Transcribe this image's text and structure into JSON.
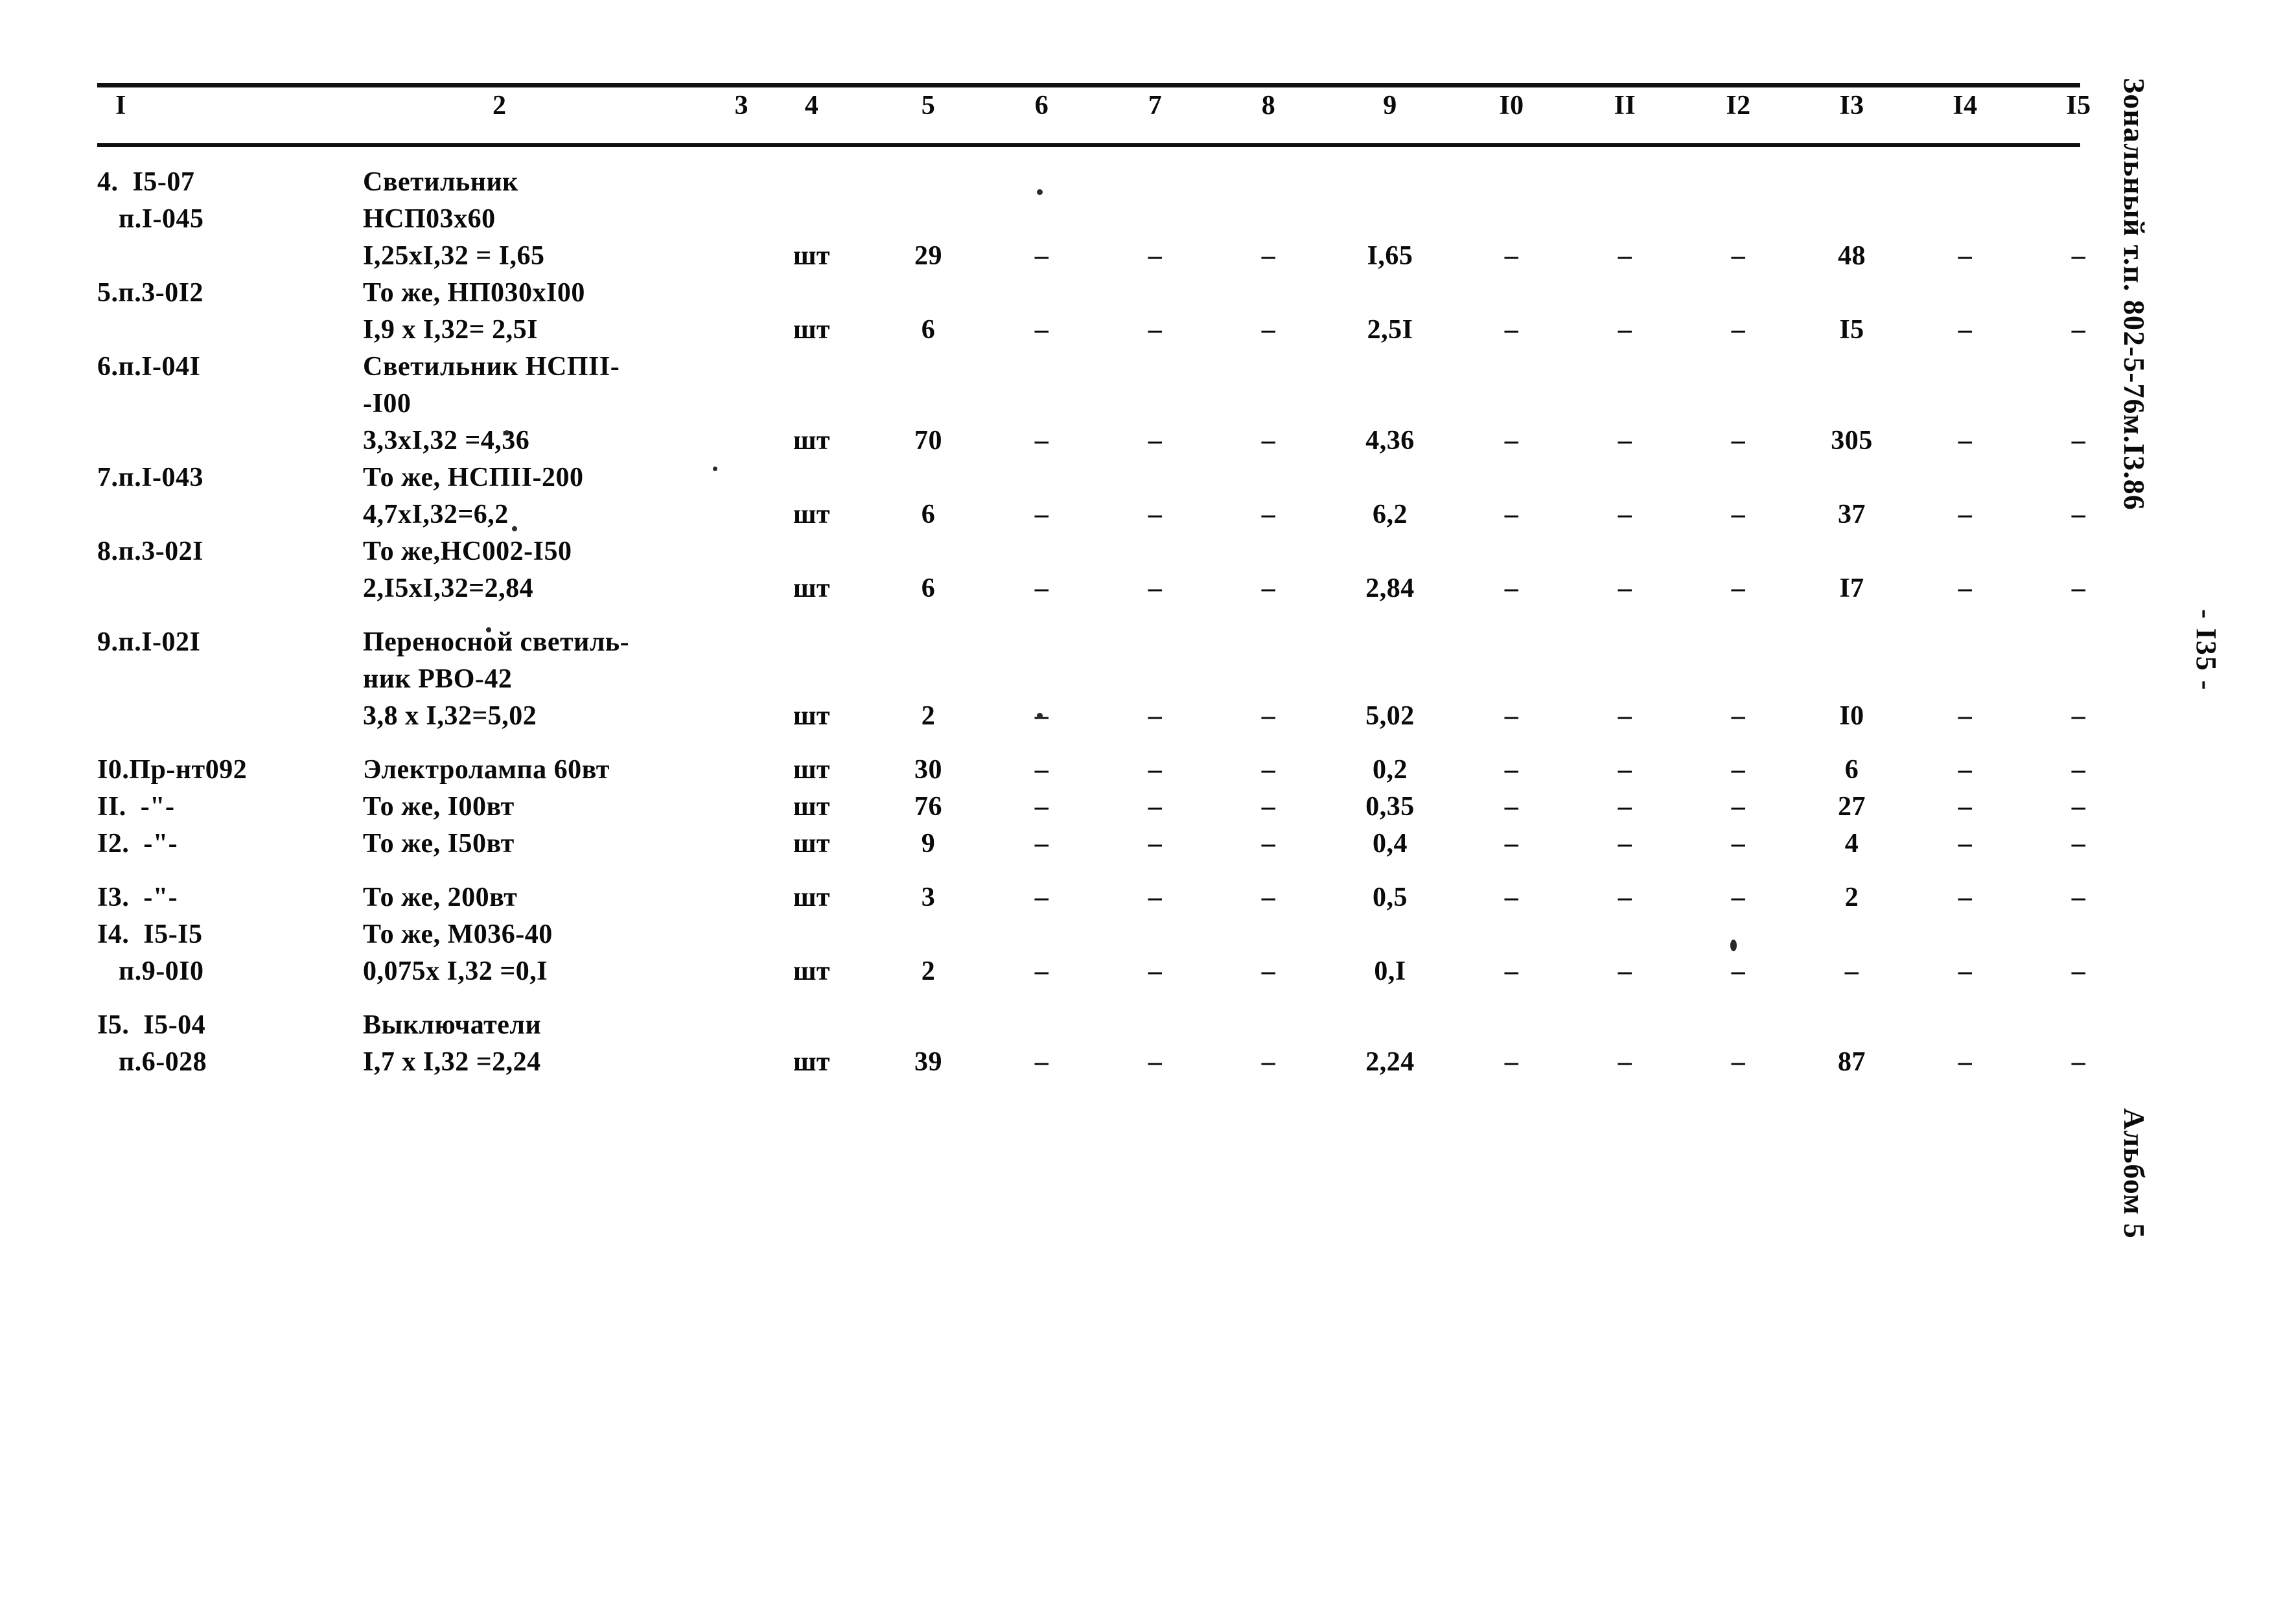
{
  "document": {
    "stamp_right": "Зональный т.п.  802-5-76м.I3.86",
    "page_number": "- I35 -",
    "album_label": "Альбом 5"
  },
  "table": {
    "column_headers": [
      "I",
      "2",
      "3",
      "4",
      "5",
      "6",
      "7",
      "8",
      "9",
      "I0",
      "II",
      "I2",
      "I3",
      "I4",
      "I5"
    ],
    "rows": [
      {
        "id": "row-4",
        "position": "4.  I5-07\n   п.I-045",
        "name": "Светильник\nНСП03х60\nI,25хI,32 = I,65",
        "unit": "шт",
        "col5": "29",
        "col6": "–",
        "col7": "–",
        "col8": "–",
        "col9": "I,65",
        "col10": "–",
        "col11": "–",
        "col12": "–",
        "col13": "48",
        "col14": "–",
        "col15": "–"
      },
      {
        "id": "row-5",
        "position": "5.п.3-0I2",
        "name": "То же, НП030хI00\nI,9 х I,32= 2,5I",
        "unit": "шт",
        "col5": "6",
        "col6": "–",
        "col7": "–",
        "col8": "–",
        "col9": "2,5I",
        "col10": "–",
        "col11": "–",
        "col12": "–",
        "col13": "I5",
        "col14": "–",
        "col15": "–"
      },
      {
        "id": "row-6",
        "position": "6.п.I-04I",
        "name": "Светильник НСПII-\n-I00\n3,3хI,32 =4,36",
        "unit": "шт",
        "col5": "70",
        "col6": "–",
        "col7": "–",
        "col8": "–",
        "col9": "4,36",
        "col10": "–",
        "col11": "–",
        "col12": "–",
        "col13": "305",
        "col14": "–",
        "col15": "–"
      },
      {
        "id": "row-7",
        "position": "7.п.I-043",
        "name": "То же, НСПII-200\n4,7хI,32=6,2",
        "unit": "шт",
        "col5": "6",
        "col6": "–",
        "col7": "–",
        "col8": "–",
        "col9": "6,2",
        "col10": "–",
        "col11": "–",
        "col12": "–",
        "col13": "37",
        "col14": "–",
        "col15": "–"
      },
      {
        "id": "row-8",
        "position": "8.п.3-02I",
        "name": "То же,НС002-I50\n2,I5хI,32=2,84",
        "unit": "шт",
        "col5": "6",
        "col6": "–",
        "col7": "–",
        "col8": "–",
        "col9": "2,84",
        "col10": "–",
        "col11": "–",
        "col12": "–",
        "col13": "I7",
        "col14": "–",
        "col15": "–"
      },
      {
        "id": "row-9",
        "position": "9.п.I-02I",
        "name": "Переносной светиль-\nник РВО-42\n3,8 х I,32=5,02",
        "unit": "шт",
        "col5": "2",
        "col6": "–",
        "col7": "–",
        "col8": "–",
        "col9": "5,02",
        "col10": "–",
        "col11": "–",
        "col12": "–",
        "col13": "I0",
        "col14": "–",
        "col15": "–"
      },
      {
        "id": "row-10",
        "position": "I0.Пр-нт092",
        "name": "Электролампа 60вт",
        "unit": "шт",
        "col5": "30",
        "col6": "–",
        "col7": "–",
        "col8": "–",
        "col9": "0,2",
        "col10": "–",
        "col11": "–",
        "col12": "–",
        "col13": "6",
        "col14": "–",
        "col15": "–"
      },
      {
        "id": "row-11",
        "position": "II.  -\"-",
        "name": "То же, I00вт",
        "unit": "шт",
        "col5": "76",
        "col6": "–",
        "col7": "–",
        "col8": "–",
        "col9": "0,35",
        "col10": "–",
        "col11": "–",
        "col12": "–",
        "col13": "27",
        "col14": "–",
        "col15": "–"
      },
      {
        "id": "row-12",
        "position": "I2.  -\"-",
        "name": "То же, I50вт",
        "unit": "шт",
        "col5": "9",
        "col6": "–",
        "col7": "–",
        "col8": "–",
        "col9": "0,4",
        "col10": "–",
        "col11": "–",
        "col12": "–",
        "col13": "4",
        "col14": "–",
        "col15": "–"
      },
      {
        "id": "row-13",
        "position": "I3.  -\"-",
        "name": "То же, 200вт",
        "unit": "шт",
        "col5": "3",
        "col6": "–",
        "col7": "–",
        "col8": "–",
        "col9": "0,5",
        "col10": "–",
        "col11": "–",
        "col12": "–",
        "col13": "2",
        "col14": "–",
        "col15": "–"
      },
      {
        "id": "row-14",
        "position": "I4.  I5-I5\n   п.9-0I0",
        "name": "То же, М036-40\n0,075х I,32 =0,I",
        "unit": "шт",
        "col5": "2",
        "col6": "–",
        "col7": "–",
        "col8": "–",
        "col9": "0,I",
        "col10": "–",
        "col11": "–",
        "col12": "–",
        "col13": "–",
        "col14": "–",
        "col15": "–"
      },
      {
        "id": "row-15",
        "position": "I5.  I5-04\n   п.6-028",
        "name": "Выключатели\nI,7 х I,32 =2,24",
        "unit": "шт",
        "col5": "39",
        "col6": "–",
        "col7": "–",
        "col8": "–",
        "col9": "2,24",
        "col10": "–",
        "col11": "–",
        "col12": "–",
        "col13": "87",
        "col14": "–",
        "col15": "–"
      }
    ]
  }
}
